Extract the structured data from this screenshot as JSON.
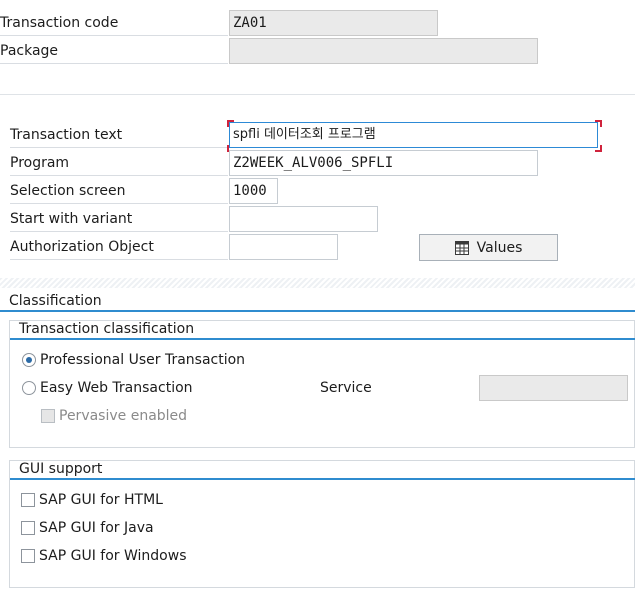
{
  "header": {
    "transaction_code_label": "Transaction code",
    "transaction_code_value": "ZA01",
    "package_label": "Package",
    "package_value": ""
  },
  "details": {
    "transaction_text_label": "Transaction text",
    "transaction_text_value": "spfli 데이터조회 프로그램",
    "program_label": "Program",
    "program_value": "Z2WEEK_ALV006_SPFLI",
    "selection_screen_label": "Selection screen",
    "selection_screen_value": "1000",
    "start_variant_label": "Start with variant",
    "start_variant_value": "",
    "auth_object_label": "Authorization Object",
    "auth_object_value": "",
    "values_button_label": "Values",
    "values_button_icon": "table-icon"
  },
  "classification": {
    "title": "Classification",
    "transaction_classification_title": "Transaction classification",
    "professional_label": "Professional User Transaction",
    "professional_selected": true,
    "easy_web_label": "Easy Web Transaction",
    "easy_web_selected": false,
    "service_label": "Service",
    "service_value": "",
    "pervasive_label": "Pervasive enabled",
    "pervasive_checked": false
  },
  "gui_support": {
    "title": "GUI support",
    "html_label": "SAP GUI for HTML",
    "java_label": "SAP GUI for Java",
    "windows_label": "SAP GUI for Windows"
  },
  "colors": {
    "accent": "#2f8ccf",
    "readonly_bg": "#eaeaea"
  }
}
